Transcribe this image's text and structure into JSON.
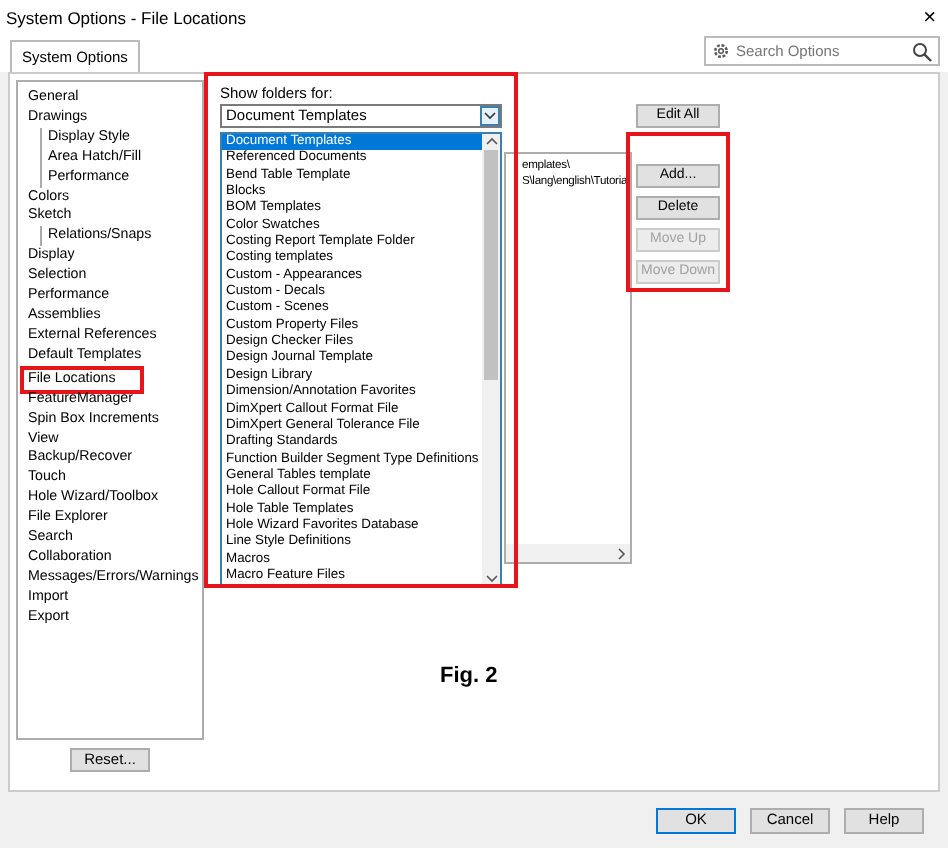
{
  "window": {
    "title": "System Options - File Locations",
    "close": "×"
  },
  "tabs": [
    {
      "label": "System Options",
      "selected": true
    }
  ],
  "search": {
    "placeholder": "Search Options"
  },
  "tree": [
    {
      "label": "General",
      "highlighted": false
    },
    {
      "label": "Drawings",
      "highlighted": false,
      "children": [
        {
          "label": "Display Style",
          "highlighted": false
        },
        {
          "label": "Area Hatch/Fill",
          "highlighted": false
        },
        {
          "label": "Performance",
          "highlighted": false
        }
      ]
    },
    {
      "label": "Colors",
      "highlighted": false
    },
    {
      "label": "Sketch",
      "highlighted": false,
      "children": [
        {
          "label": "Relations/Snaps",
          "highlighted": false
        }
      ]
    },
    {
      "label": "Display",
      "highlighted": false
    },
    {
      "label": "Selection",
      "highlighted": false
    },
    {
      "label": "Performance",
      "highlighted": false
    },
    {
      "label": "Assemblies",
      "highlighted": false
    },
    {
      "label": "External References",
      "highlighted": false
    },
    {
      "label": "Default Templates",
      "highlighted": false
    },
    {
      "label": "File Locations",
      "highlighted": true
    },
    {
      "label": "FeatureManager",
      "highlighted": false
    },
    {
      "label": "Spin Box Increments",
      "highlighted": false
    },
    {
      "label": "View",
      "highlighted": false
    },
    {
      "label": "Backup/Recover",
      "highlighted": false
    },
    {
      "label": "Touch",
      "highlighted": false
    },
    {
      "label": "Hole Wizard/Toolbox",
      "highlighted": false
    },
    {
      "label": "File Explorer",
      "highlighted": false
    },
    {
      "label": "Search",
      "highlighted": false
    },
    {
      "label": "Collaboration",
      "highlighted": false
    },
    {
      "label": "Messages/Errors/Warnings",
      "highlighted": false
    },
    {
      "label": "Import",
      "highlighted": false
    },
    {
      "label": "Export",
      "highlighted": false
    }
  ],
  "reset_button": "Reset...",
  "show_folders": {
    "label": "Show folders for:",
    "value": "Document Templates",
    "highlighted": true,
    "options": [
      {
        "label": "Document Templates",
        "selected": true
      },
      {
        "label": "Referenced Documents",
        "selected": false
      },
      {
        "label": "Bend Table Template",
        "selected": false
      },
      {
        "label": "Blocks",
        "selected": false
      },
      {
        "label": "BOM Templates",
        "selected": false
      },
      {
        "label": "Color Swatches",
        "selected": false
      },
      {
        "label": "Costing Report Template Folder",
        "selected": false
      },
      {
        "label": "Costing templates",
        "selected": false
      },
      {
        "label": "Custom - Appearances",
        "selected": false
      },
      {
        "label": "Custom - Decals",
        "selected": false
      },
      {
        "label": "Custom - Scenes",
        "selected": false
      },
      {
        "label": "Custom Property Files",
        "selected": false
      },
      {
        "label": "Design Checker Files",
        "selected": false
      },
      {
        "label": "Design Journal Template",
        "selected": false
      },
      {
        "label": "Design Library",
        "selected": false
      },
      {
        "label": "Dimension/Annotation Favorites",
        "selected": false
      },
      {
        "label": "DimXpert Callout Format File",
        "selected": false
      },
      {
        "label": "DimXpert General Tolerance File",
        "selected": false
      },
      {
        "label": "Drafting Standards",
        "selected": false
      },
      {
        "label": "Function Builder Segment Type Definitions",
        "selected": false
      },
      {
        "label": "General Tables template",
        "selected": false
      },
      {
        "label": "Hole Callout Format File",
        "selected": false
      },
      {
        "label": "Hole Table Templates",
        "selected": false
      },
      {
        "label": "Hole Wizard Favorites Database",
        "selected": false
      },
      {
        "label": "Line Style Definitions",
        "selected": false
      },
      {
        "label": "Macros",
        "selected": false
      },
      {
        "label": "Macro Feature Files",
        "selected": false
      }
    ]
  },
  "folders": [
    "emplates\\",
    "S\\lang\\english\\Tutoria"
  ],
  "edit_all_button": "Edit All",
  "folder_buttons": {
    "highlighted": true,
    "items": [
      {
        "label": "Add...",
        "disabled": false
      },
      {
        "label": "Delete",
        "disabled": false
      },
      {
        "label": "Move Up",
        "disabled": true
      },
      {
        "label": "Move Down",
        "disabled": true
      }
    ]
  },
  "figure_caption": "Fig. 2",
  "dialog_buttons": [
    {
      "label": "OK",
      "default": true
    },
    {
      "label": "Cancel",
      "default": false
    },
    {
      "label": "Help",
      "default": false
    }
  ]
}
